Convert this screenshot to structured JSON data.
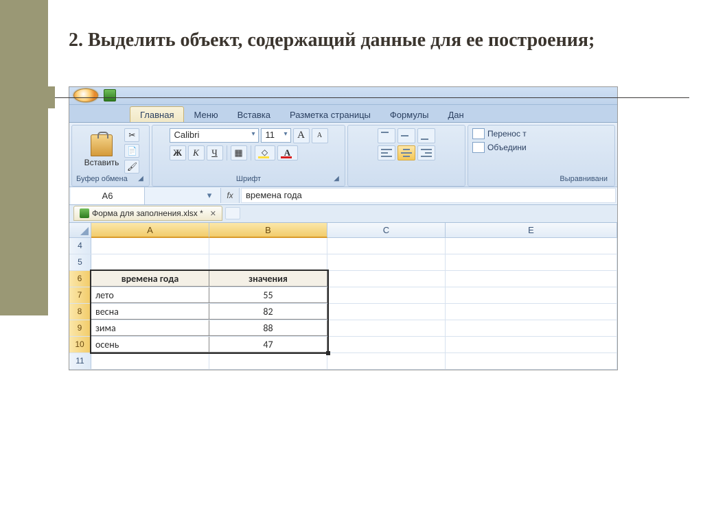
{
  "title": "2. Выделить объект, содержащий данные для ее построения;",
  "tabs": {
    "home": "Главная",
    "menu": "Меню",
    "insert": "Вставка",
    "layout": "Разметка страницы",
    "formulas": "Формулы",
    "data": "Дан"
  },
  "ribbon": {
    "paste": "Вставить",
    "clipboard_label": "Буфер обмена",
    "font_name": "Calibri",
    "font_size": "11",
    "font_label": "Шрифт",
    "wrap": "Перенос т",
    "merge": "Объедини",
    "alignment_label": "Выравнивани"
  },
  "formula_bar": {
    "name_box": "A6",
    "formula": "времена года"
  },
  "document_tab": "Форма для заполнения.xlsx *",
  "columns": [
    "A",
    "B",
    "C",
    "E"
  ],
  "row_headers": [
    "4",
    "5",
    "6",
    "7",
    "8",
    "9",
    "10",
    "11"
  ],
  "table": {
    "header_a": "времена года",
    "header_b": "значения",
    "rows": [
      {
        "a": "лето",
        "b": "55"
      },
      {
        "a": "весна",
        "b": "82"
      },
      {
        "a": "зима",
        "b": "88"
      },
      {
        "a": "осень",
        "b": "47"
      }
    ]
  },
  "chart_data": {
    "type": "table",
    "title": "времена года / значения",
    "columns": [
      "времена года",
      "значения"
    ],
    "rows": [
      [
        "лето",
        55
      ],
      [
        "весна",
        82
      ],
      [
        "зима",
        88
      ],
      [
        "осень",
        47
      ]
    ]
  }
}
